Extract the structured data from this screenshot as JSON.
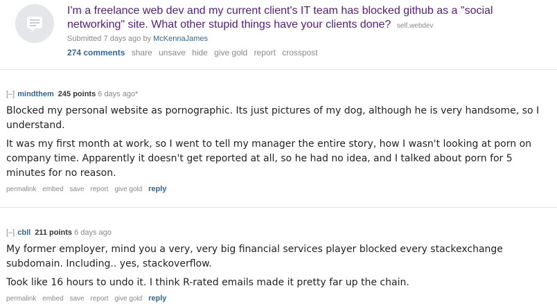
{
  "post": {
    "thumbnail_icon": "self-text-comment-icon",
    "title": "I'm a freelance web dev and my current client's IT team has blocked github as a \"social networking\" site. What other stupid things have your clients done?",
    "domain": "self.webdev",
    "submitted_prefix": "Submitted 7 days ago by",
    "author": "McKennaJames",
    "buttons": {
      "comments": "274 comments",
      "share": "share",
      "unsave": "unsave",
      "hide": "hide",
      "give_gold": "give gold",
      "report": "report",
      "crosspost": "crosspost"
    }
  },
  "comments": [
    {
      "expand": "[–]",
      "author": "mindthem",
      "score": "245 points",
      "time": "6 days ago*",
      "paragraphs": [
        "Blocked my personal website as pornographic. Its just pictures of my dog, although he is very handsome, so I understand.",
        "It was my first month at work, so I went to tell my manager the entire story, how I wasn't looking at porn on company time. Apparently it doesn't get reported at all, so he had no idea, and I talked about porn for 5 minutes for no reason."
      ],
      "buttons": {
        "permalink": "permalink",
        "embed": "embed",
        "save": "save",
        "report": "report",
        "give_gold": "give gold",
        "reply": "reply"
      }
    },
    {
      "expand": "[–]",
      "author": "cbll",
      "score": "211 points",
      "time": "6 days ago",
      "paragraphs": [
        "My former employer, mind you a very, very big financial services player blocked every stackexchange subdomain. Including.. yes, stackoverflow.",
        "Took like 16 hours to undo it. I think R-rated emails made it pretty far up the chain."
      ],
      "buttons": {
        "permalink": "permalink",
        "embed": "embed",
        "save": "save",
        "report": "report",
        "give_gold": "give gold",
        "reply": "reply"
      }
    }
  ]
}
